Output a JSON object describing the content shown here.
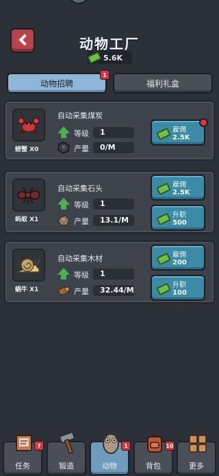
{
  "header": {
    "title": "动物工厂",
    "currency": "5.6K"
  },
  "tabs": [
    {
      "label": "动物招聘",
      "badge": "1"
    },
    {
      "label": "福利礼盒"
    }
  ],
  "animals": [
    {
      "name": "螃蟹",
      "count": "X0",
      "icon": "crab-icon",
      "task": "自动采集煤炭",
      "level_label": "等级",
      "level": "1",
      "output_label": "产量",
      "output": "0/M",
      "resource_icon": "coal-icon",
      "hire_label": "雇佣",
      "hire_cost": "2.5K",
      "hire_alert": true
    },
    {
      "name": "蚂蚁",
      "count": "X1",
      "icon": "ant-icon",
      "task": "自动采集石头",
      "level_label": "等级",
      "level": "1",
      "output_label": "产量",
      "output": "13.1/M",
      "resource_icon": "stone-icon",
      "hire_label": "雇佣",
      "hire_cost": "2.5K",
      "upgrade_label": "升职",
      "upgrade_cost": "500"
    },
    {
      "name": "蜗牛",
      "count": "X1",
      "icon": "snail-icon",
      "task": "自动采集木材",
      "level_label": "等级",
      "level": "1",
      "output_label": "产量",
      "output": "32.44/M",
      "resource_icon": "wood-icon",
      "hire_label": "雇佣",
      "hire_cost": "200",
      "upgrade_label": "升职",
      "upgrade_cost": "100"
    }
  ],
  "nav": [
    {
      "label": "任务",
      "icon": "task-board-icon",
      "badge": "7"
    },
    {
      "label": "锻造",
      "icon": "hammer-icon"
    },
    {
      "label": "动物",
      "icon": "owl-icon",
      "badge": "1",
      "active": true
    },
    {
      "label": "背包",
      "icon": "backpack-icon",
      "badge": "10"
    },
    {
      "label": "更多",
      "icon": "more-grid-icon"
    }
  ],
  "colors": {
    "accent_blue": "#3d8aa6",
    "badge_red": "#d8353f",
    "back_red": "#b8434d",
    "cash_green": "#6fbf4a"
  }
}
